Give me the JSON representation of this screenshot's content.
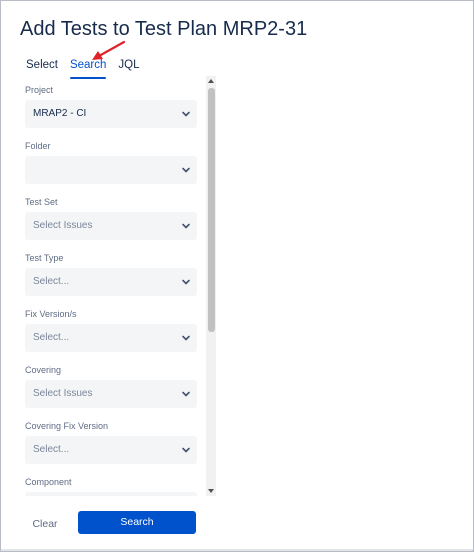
{
  "dialog": {
    "title": "Add Tests to Test Plan MRP2-31"
  },
  "tabs": [
    {
      "label": "Select",
      "active": false
    },
    {
      "label": "Search",
      "active": true
    },
    {
      "label": "JQL",
      "active": false
    }
  ],
  "annotation": {
    "arrow_color": "#e0232b"
  },
  "filters": [
    {
      "label": "Project",
      "value": "MRAP2 - CI",
      "filled": true
    },
    {
      "label": "Folder",
      "value": "",
      "filled": false
    },
    {
      "label": "Test Set",
      "value": "Select Issues",
      "filled": false
    },
    {
      "label": "Test Type",
      "value": "Select...",
      "filled": false
    },
    {
      "label": "Fix Version/s",
      "value": "Select...",
      "filled": false
    },
    {
      "label": "Covering",
      "value": "Select Issues",
      "filled": false
    },
    {
      "label": "Covering Fix Version",
      "value": "Select...",
      "filled": false
    },
    {
      "label": "Component",
      "value": "",
      "filled": false
    }
  ],
  "footer": {
    "clear_label": "Clear",
    "search_label": "Search"
  },
  "colors": {
    "primary": "#0052cc",
    "text": "#172b4d",
    "field_bg": "#f4f5f7"
  },
  "icons": {
    "dropdown": "chevron-down-icon",
    "annotation": "red-arrow-icon"
  }
}
